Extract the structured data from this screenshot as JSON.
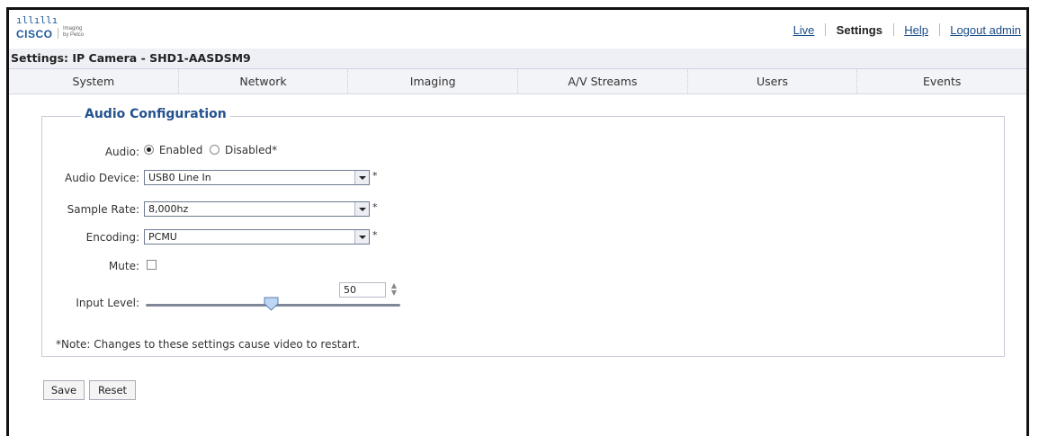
{
  "brand": {
    "logo_text": "CISCO",
    "sub_brand": "Imaging by Pelco"
  },
  "top_nav": {
    "live": "Live",
    "settings": "Settings",
    "help": "Help",
    "logout": "Logout admin"
  },
  "page_title": "Settings: IP Camera - SHD1-AASDSM9",
  "tabs": [
    "System",
    "Network",
    "Imaging",
    "A/V Streams",
    "Users",
    "Events"
  ],
  "section_title": "Audio Configuration",
  "form": {
    "audio_label": "Audio:",
    "audio_enabled_label": "Enabled",
    "audio_disabled_label": "Disabled*",
    "audio_selected": "Enabled",
    "device_label": "Audio Device:",
    "device_value": "USB0 Line In",
    "sample_rate_label": "Sample Rate:",
    "sample_rate_value": "8,000hz",
    "encoding_label": "Encoding:",
    "encoding_value": "PCMU",
    "required_marker": "*",
    "mute_label": "Mute:",
    "mute_checked": false,
    "input_level_label": "Input Level:",
    "input_level_value": "50"
  },
  "note": "*Note: Changes to these settings cause video to restart.",
  "buttons": {
    "save": "Save",
    "reset": "Reset"
  },
  "colors": {
    "accent": "#24528f",
    "link": "#1a4c86",
    "header_bg": "#eef0f6"
  },
  "icons": {
    "dropdown": "chevron-down-icon",
    "spinner": "spinner-arrows-icon",
    "slider": "slider-handle-icon"
  }
}
